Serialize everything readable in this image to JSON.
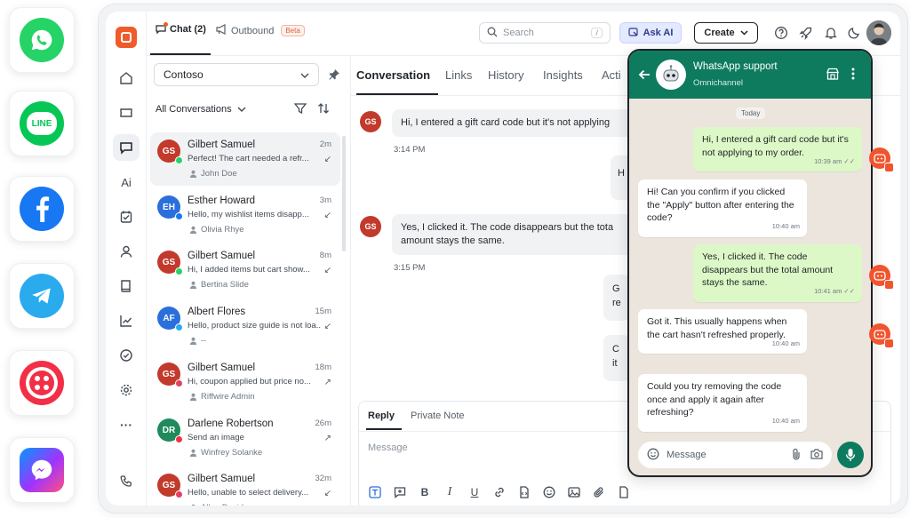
{
  "channels": [
    {
      "name": "whatsapp-icon",
      "color": "#25D366"
    },
    {
      "name": "line-icon",
      "color": "#06C755",
      "text": "LINE"
    },
    {
      "name": "facebook-icon",
      "color": "#1877F2"
    },
    {
      "name": "telegram-icon",
      "color": "#2AABEE"
    },
    {
      "name": "twilio-icon",
      "color": "#F22F46"
    },
    {
      "name": "messenger-icon",
      "color": "#A334FA"
    }
  ],
  "header": {
    "chat_tab": "Chat (2)",
    "outbound_tab": "Outbound",
    "beta_badge": "Beta",
    "search_placeholder": "Search",
    "search_shortcut": "/",
    "ask_ai": "Ask AI",
    "create": "Create"
  },
  "rail": {
    "items": [
      "home-icon",
      "ticket-icon",
      "chat-icon",
      "ai-icon",
      "tasks-icon",
      "contacts-icon",
      "knowledge-icon",
      "reports-icon",
      "check-icon",
      "settings-icon",
      "more-icon",
      "phone-icon"
    ],
    "ai_label": "Ai",
    "more_label": "···"
  },
  "list": {
    "inbox": "Contoso",
    "filter_label": "All Conversations",
    "conversations": [
      {
        "initials": "GS",
        "name": "Gilbert Samuel",
        "time": "2m",
        "message": "Perfect! The cart needed a refr...",
        "agent": "John Doe",
        "avatar_color": "#c23a2b",
        "badge_color": "#25D366",
        "arrow": "↙",
        "selected": true
      },
      {
        "initials": "EH",
        "name": "Esther Howard",
        "time": "3m",
        "message": "Hello, my wishlist items disapp...",
        "agent": "Olivia Rhye",
        "avatar_color": "#2a6fdb",
        "badge_color": "#1877F2",
        "arrow": "↙"
      },
      {
        "initials": "GS",
        "name": "Gilbert Samuel",
        "time": "8m",
        "message": "Hi, I added items but cart show...",
        "agent": "Bertina Slide",
        "avatar_color": "#c23a2b",
        "badge_color": "#25D366",
        "arrow": "↙"
      },
      {
        "initials": "AF",
        "name": "Albert Flores",
        "time": "15m",
        "message": "Hello, product size guide is not loa...",
        "agent": "--",
        "avatar_color": "#2a6fdb",
        "badge_color": "#2AABEE",
        "arrow": "↙"
      },
      {
        "initials": "GS",
        "name": "Gilbert Samuel",
        "time": "18m",
        "message": "Hi, coupon applied but price no...",
        "agent": "Riffwire Admin",
        "avatar_color": "#c23a2b",
        "badge_color": "#E4405F",
        "arrow": "↗"
      },
      {
        "initials": "DR",
        "name": "Darlene Robertson",
        "time": "26m",
        "message": "Send an image",
        "agent": "Winfrey Solanke",
        "avatar_color": "#1f8a5b",
        "badge_color": "#F22F46",
        "arrow": "↗"
      },
      {
        "initials": "GS",
        "name": "Gilbert Samuel",
        "time": "32m",
        "message": "Hello, unable to select delivery...",
        "agent": "Allen Davidson",
        "avatar_color": "#c23a2b",
        "badge_color": "#E4405F",
        "arrow": "↙"
      }
    ]
  },
  "conversation": {
    "tabs": [
      "Conversation",
      "Links",
      "History",
      "Insights",
      "Acti"
    ],
    "messages": [
      {
        "initials": "GS",
        "text": "Hi, I entered a gift card code but it's not applying",
        "time": "3:14 PM"
      },
      {
        "initials": "GS",
        "text": "Yes, I clicked it. The code disappears but the tota",
        "text2": "amount stays the same.",
        "time": "3:15 PM"
      }
    ],
    "partial_right": [
      "H",
      "G",
      "re",
      "C",
      "it"
    ],
    "reply_tab": "Reply",
    "note_tab": "Private Note",
    "composer_placeholder": "Message"
  },
  "whatsapp": {
    "name": "WhatsApp support",
    "subtitle": "Omnichannel",
    "date_chip": "Today",
    "messages": [
      {
        "dir": "out",
        "text": "Hi, I entered a gift card code but it's not applying to my order.",
        "time": "10:39 am ✓✓"
      },
      {
        "dir": "in",
        "text": "Hi! Can you confirm if you clicked the \"Apply\" button after entering the code?",
        "time": "10:40 am"
      },
      {
        "dir": "out",
        "text": "Yes, I clicked it. The code disappears but the total amount stays the same.",
        "time": "10:41 am ✓✓"
      },
      {
        "dir": "in",
        "text": "Got it. This usually happens when the cart hasn't refreshed properly.",
        "time": "10:40 am"
      },
      {
        "dir": "in",
        "text": "Could you try removing the code once and apply it again after refreshing?",
        "time": "10:40 am"
      }
    ],
    "input_placeholder": "Message"
  }
}
